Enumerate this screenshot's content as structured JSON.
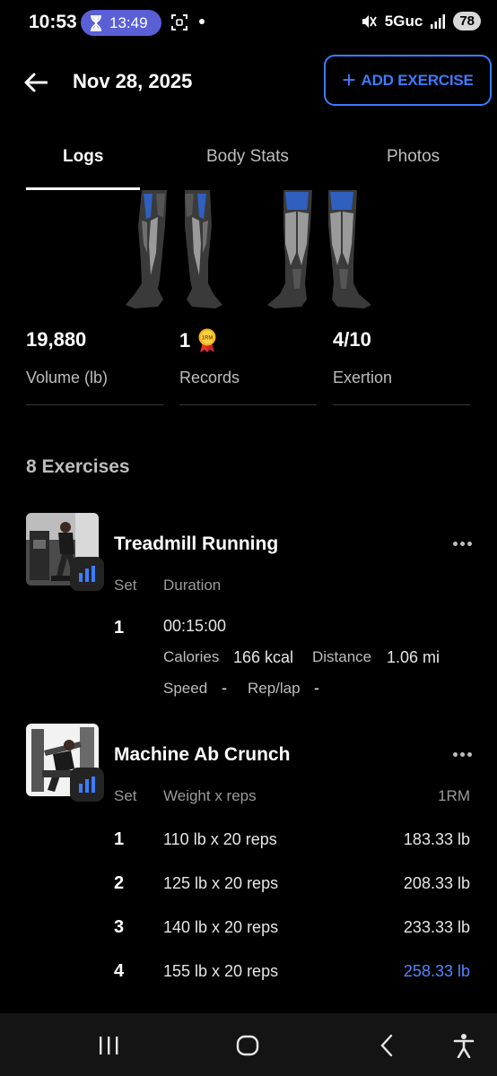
{
  "status_bar": {
    "time": "10:53",
    "timer": "13:49",
    "network": "5Guc",
    "battery": "78",
    "icons": [
      "hourglass-icon",
      "screenshot-icon",
      "mute-icon",
      "signal-icon"
    ]
  },
  "header": {
    "date": "Nov 28, 2025",
    "add_button_icon": "+",
    "add_button_label": "ADD EXERCISE",
    "accent_color": "#3d7bff"
  },
  "tabs": [
    {
      "label": "Logs",
      "active": true
    },
    {
      "label": "Body Stats",
      "active": false
    },
    {
      "label": "Photos",
      "active": false
    }
  ],
  "stats": [
    {
      "value": "19,880",
      "label": "Volume (lb)"
    },
    {
      "value": "1",
      "label": "Records",
      "badge": "1RM"
    },
    {
      "value": "4/10",
      "label": "Exertion"
    }
  ],
  "exercises_heading": "8 Exercises",
  "exercises": [
    {
      "name": "Treadmill Running",
      "columns": [
        "Set",
        "Duration"
      ],
      "sets": [
        {
          "set": "1",
          "duration": "00:15:00",
          "calories_label": "Calories",
          "calories": "166 kcal",
          "distance_label": "Distance",
          "distance": "1.06 mi",
          "speed_label": "Speed",
          "speed": "-",
          "replap_label": "Rep/lap",
          "replap": "-"
        }
      ]
    },
    {
      "name": "Machine Ab Crunch",
      "columns": [
        "Set",
        "Weight x reps",
        "1RM"
      ],
      "sets": [
        {
          "set": "1",
          "weight_reps": "110 lb x 20 reps",
          "one_rm": "183.33 lb",
          "record": false
        },
        {
          "set": "2",
          "weight_reps": "125 lb x 20 reps",
          "one_rm": "208.33 lb",
          "record": false
        },
        {
          "set": "3",
          "weight_reps": "140 lb x 20 reps",
          "one_rm": "233.33 lb",
          "record": false
        },
        {
          "set": "4",
          "weight_reps": "155 lb x 20 reps",
          "one_rm": "258.33 lb",
          "record": true
        }
      ]
    }
  ],
  "nav_bar": {
    "buttons": [
      "recents-icon",
      "home-icon",
      "back-icon",
      "accessibility-icon"
    ]
  }
}
